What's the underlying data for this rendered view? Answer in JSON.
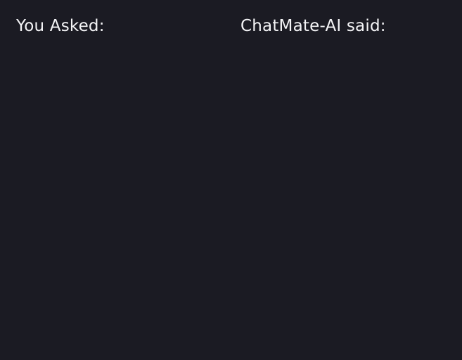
{
  "user_panel": {
    "heading": "You Asked:",
    "message": ""
  },
  "ai_panel": {
    "heading": "ChatMate-AI said:",
    "response": ""
  },
  "colors": {
    "background": "#1b1b23",
    "text": "#f4f4f6"
  }
}
